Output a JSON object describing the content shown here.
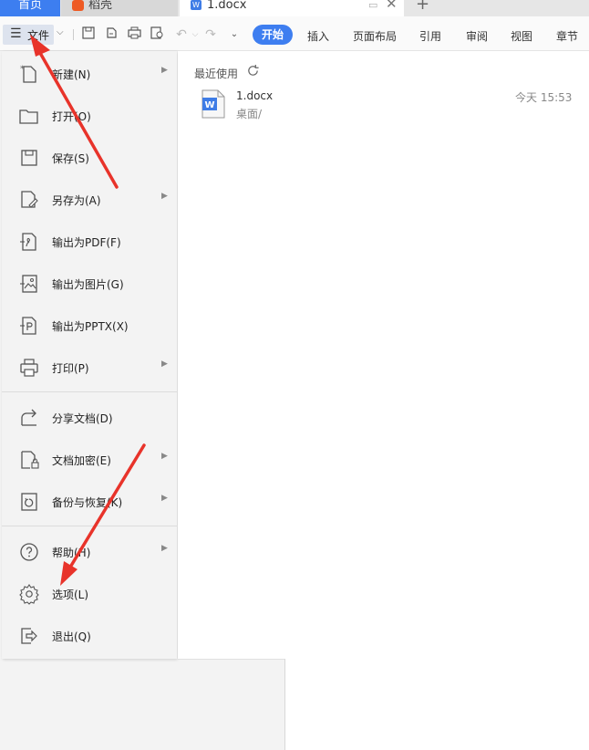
{
  "tabs": {
    "home": "首页",
    "daoke": "稻壳",
    "doc": "1.docx"
  },
  "toolbar": {
    "file_label": "文件",
    "ribbon": [
      "开始",
      "插入",
      "页面布局",
      "引用",
      "审阅",
      "视图",
      "章节"
    ]
  },
  "menu": {
    "items": [
      {
        "label": "新建(N)",
        "icon": "new-icon",
        "submenu": true
      },
      {
        "label": "打开(O)",
        "icon": "folder-icon",
        "submenu": false
      },
      {
        "label": "保存(S)",
        "icon": "save-icon",
        "submenu": false
      },
      {
        "label": "另存为(A)",
        "icon": "save-as-icon",
        "submenu": true
      },
      {
        "label": "输出为PDF(F)",
        "icon": "pdf-icon",
        "submenu": false
      },
      {
        "label": "输出为图片(G)",
        "icon": "image-icon",
        "submenu": false
      },
      {
        "label": "输出为PPTX(X)",
        "icon": "pptx-icon",
        "submenu": false
      },
      {
        "label": "打印(P)",
        "icon": "print-icon",
        "submenu": true
      },
      {
        "label": "分享文档(D)",
        "icon": "share-icon",
        "submenu": false
      },
      {
        "label": "文档加密(E)",
        "icon": "lock-doc-icon",
        "submenu": true
      },
      {
        "label": "备份与恢复(K)",
        "icon": "backup-icon",
        "submenu": true
      },
      {
        "label": "帮助(H)",
        "icon": "help-icon",
        "submenu": true
      },
      {
        "label": "选项(L)",
        "icon": "gear-icon",
        "submenu": false
      },
      {
        "label": "退出(Q)",
        "icon": "exit-icon",
        "submenu": false
      }
    ]
  },
  "recent": {
    "title": "最近使用",
    "files": [
      {
        "name": "1.docx",
        "path": "桌面/",
        "time": "今天 15:53"
      }
    ]
  },
  "colors": {
    "accent": "#3e7ef0",
    "annotation": "#e8332a"
  }
}
